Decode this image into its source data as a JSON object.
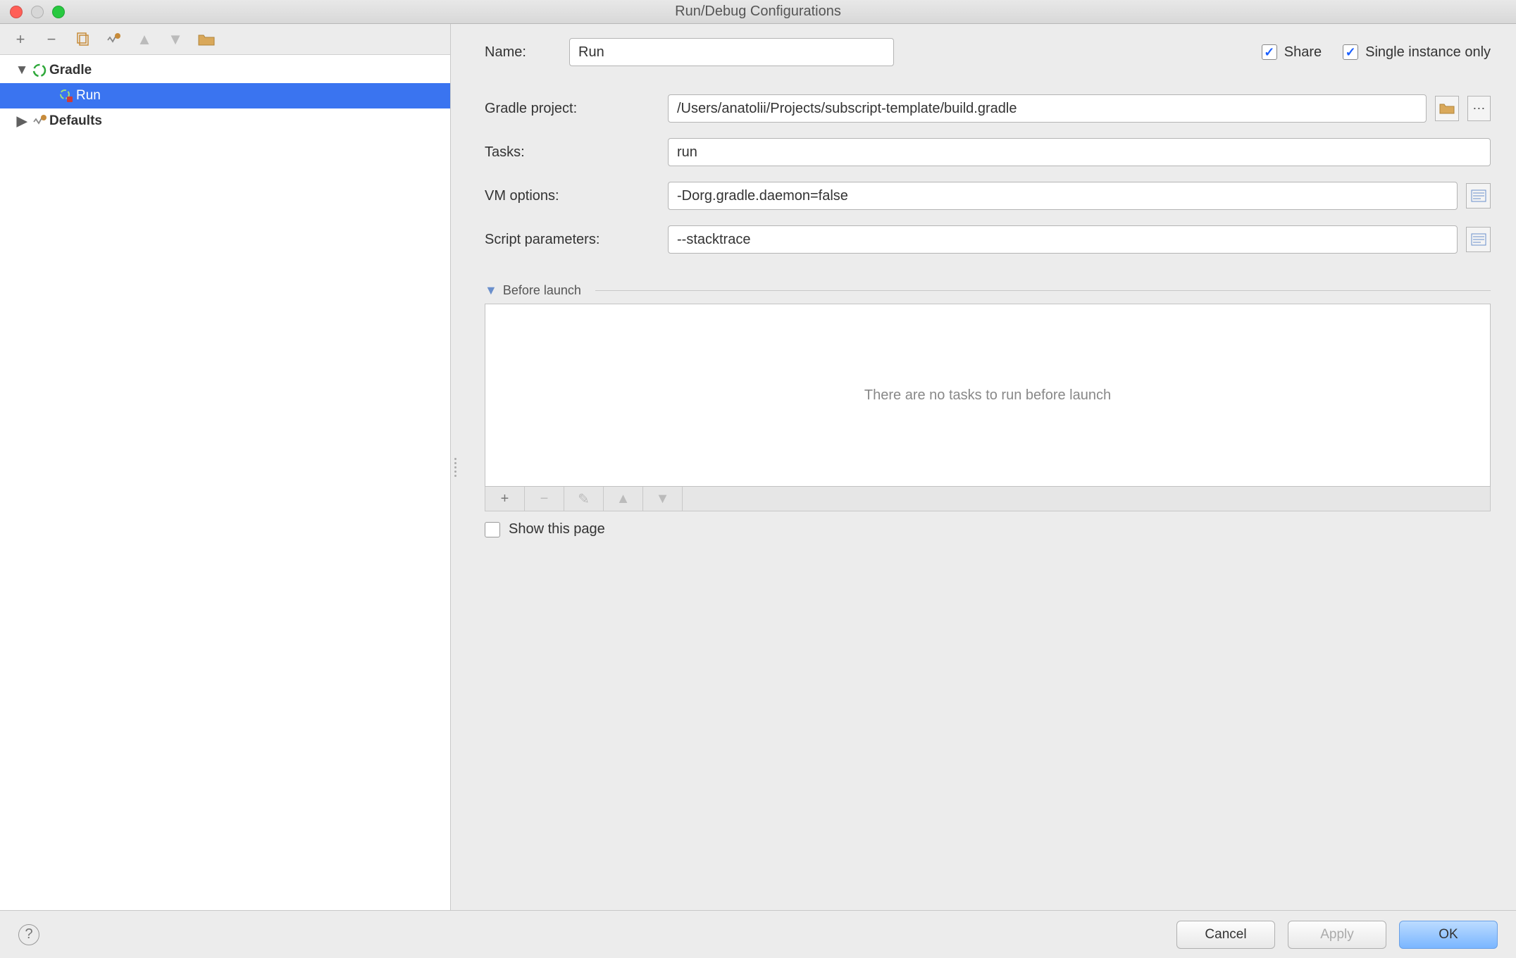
{
  "title": "Run/Debug Configurations",
  "toolbar": {
    "add": "+",
    "remove": "−",
    "copy": "",
    "wrench": "",
    "up": "▲",
    "down": "▼",
    "folder": ""
  },
  "tree": {
    "gradle": {
      "label": "Gradle"
    },
    "run": {
      "label": "Run"
    },
    "defaults": {
      "label": "Defaults"
    }
  },
  "form": {
    "name_label": "Name:",
    "name_value": "Run",
    "share_label": "Share",
    "single_instance_label": "Single instance only",
    "gradle_project_label": "Gradle project:",
    "gradle_project_value": "/Users/anatolii/Projects/subscript-template/build.gradle",
    "tasks_label": "Tasks:",
    "tasks_value": "run",
    "vm_label": "VM options:",
    "vm_value": "-Dorg.gradle.daemon=false",
    "script_label": "Script parameters:",
    "script_value": "--stacktrace"
  },
  "before": {
    "title": "Before launch",
    "empty": "There are no tasks to run before launch",
    "show_label": "Show this page"
  },
  "footer": {
    "cancel": "Cancel",
    "apply": "Apply",
    "ok": "OK"
  }
}
